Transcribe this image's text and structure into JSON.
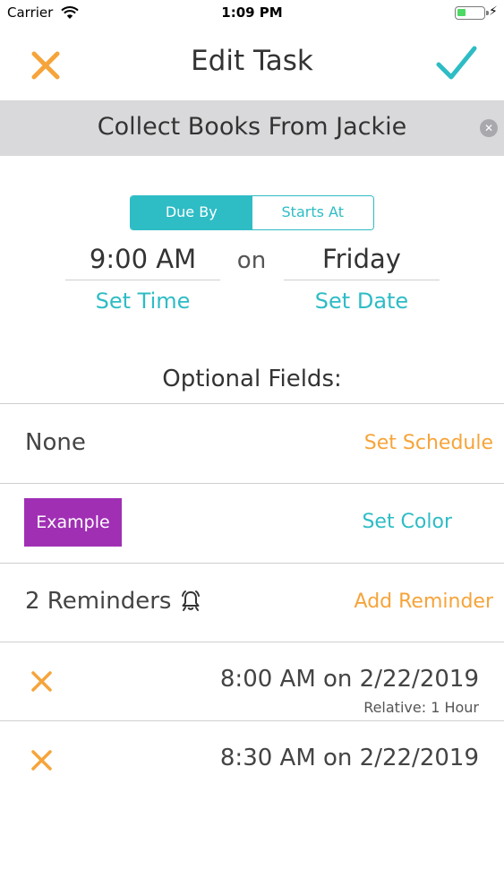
{
  "status_bar": {
    "carrier": "Carrier",
    "time": "1:09 PM"
  },
  "nav": {
    "title": "Edit Task",
    "close_icon": "x-icon",
    "confirm_icon": "checkmark-icon"
  },
  "task": {
    "name": "Collect Books From Jackie"
  },
  "segment": {
    "options": [
      "Due By",
      "Starts At"
    ],
    "selected": "Due By"
  },
  "schedule": {
    "time_value": "9:00 AM",
    "on_label": "on",
    "date_value": "Friday",
    "set_time_label": "Set Time",
    "set_date_label": "Set Date"
  },
  "optional": {
    "title": "Optional Fields:",
    "schedule_value": "None",
    "set_schedule_label": "Set Schedule",
    "color_chip_label": "Example",
    "set_color_label": "Set Color",
    "reminders_count_label": "2 Reminders",
    "add_reminder_label": "Add Reminder"
  },
  "reminders": [
    {
      "text": "8:00 AM on 2/22/2019",
      "sub": "Relative: 1 Hour"
    },
    {
      "text": "8:30 AM on 2/22/2019",
      "sub": ""
    }
  ],
  "colors": {
    "accent_teal": "#2ebcc5",
    "accent_orange": "#f6a43a",
    "chip_purple": "#a02fb4",
    "task_bar_gray": "#d9d9db"
  }
}
